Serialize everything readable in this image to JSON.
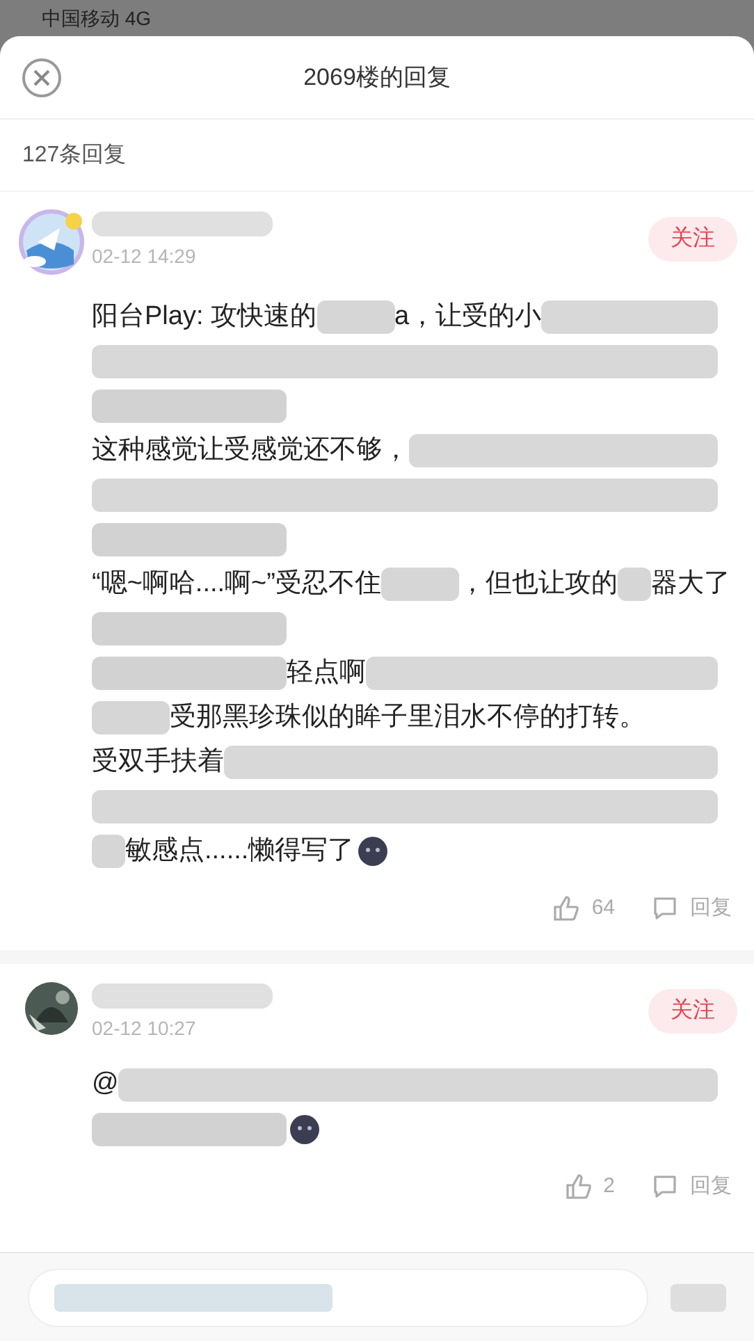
{
  "status_bar": {
    "carrier": "中国移动 4G"
  },
  "sheet": {
    "title": "2069楼的回复",
    "count": "127条回复"
  },
  "comments": [
    {
      "time": "02-12 14:29",
      "follow": "关注",
      "likes": "64",
      "reply": "回复",
      "lines": [
        [
          {
            "kind": "text",
            "text": "阳台Play: 攻快速的"
          },
          {
            "kind": "mask"
          },
          {
            "kind": "text",
            "text": "a，让受的小"
          },
          {
            "kind": "mask_long"
          }
        ],
        [
          {
            "kind": "mask_long"
          }
        ],
        [
          {
            "kind": "mask_wide"
          }
        ],
        [
          {
            "kind": "text",
            "text": "这种感觉让受感觉还不够，"
          },
          {
            "kind": "mask_long"
          }
        ],
        [
          {
            "kind": "mask_long"
          }
        ],
        [
          {
            "kind": "mask_wide"
          }
        ],
        [
          {
            "kind": "text",
            "text": "“嗯~啊哈....啊~”受忍不住"
          },
          {
            "kind": "mask"
          },
          {
            "kind": "text",
            "text": "，但也让攻的"
          },
          {
            "kind": "mask_small"
          },
          {
            "kind": "text",
            "text": "器大了"
          }
        ],
        [
          {
            "kind": "mask_wide"
          }
        ],
        [
          {
            "kind": "mask_wide"
          },
          {
            "kind": "text",
            "text": "轻点啊"
          },
          {
            "kind": "mask_long"
          }
        ],
        [
          {
            "kind": "mask"
          },
          {
            "kind": "text",
            "text": "受那黑珍珠似的眸子里泪水不停的打转。"
          }
        ],
        [
          {
            "kind": "text",
            "text": "受双手扶着"
          },
          {
            "kind": "mask_long"
          }
        ],
        [
          {
            "kind": "mask_long"
          }
        ],
        [
          {
            "kind": "mask_small"
          },
          {
            "kind": "text",
            "text": "敏感点......懒得写了"
          },
          {
            "kind": "emoji"
          }
        ]
      ]
    },
    {
      "time": "02-12 10:27",
      "follow": "关注",
      "likes": "2",
      "reply": "回复",
      "lines": [
        [
          {
            "kind": "text",
            "text": "@"
          },
          {
            "kind": "mask_long"
          }
        ],
        [
          {
            "kind": "mask_wide"
          },
          {
            "kind": "emoji"
          }
        ]
      ]
    }
  ]
}
